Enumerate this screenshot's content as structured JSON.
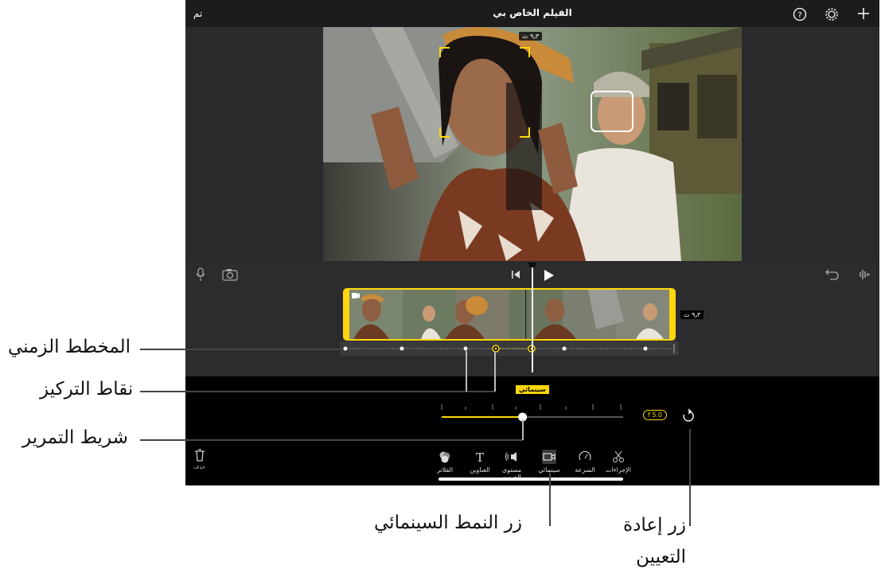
{
  "app": {
    "title": "الفيلم الخاص بي",
    "done_label": "تم",
    "duration_top": "٩٫٣ ث",
    "duration_clip": "٩٫٣ ث",
    "cinematic_badge": "سينمائي",
    "fstop_label": "f 5.0",
    "delete_label": "حذف",
    "accent_color": "#ffd60a",
    "scrubber_level": 0.48
  },
  "toolbar": [
    {
      "name": "actions",
      "label": "الإجراءات",
      "icon": "scissors-icon"
    },
    {
      "name": "speed",
      "label": "السرعة",
      "icon": "speedometer-icon"
    },
    {
      "name": "cinematic",
      "label": "سينمائي",
      "icon": "cinematic-camera-icon"
    },
    {
      "name": "volume",
      "label": "مستوى الصوت",
      "icon": "speaker-icon"
    },
    {
      "name": "titles",
      "label": "العناوين",
      "icon": "text-T-icon"
    },
    {
      "name": "filters",
      "label": "الفلاتر",
      "icon": "filters-circles-icon"
    }
  ],
  "callouts": {
    "timeline": "المخطط الزمني",
    "focus_points": "نقاط التركيز",
    "scrubber": "شريط التمرير",
    "cinematic_button": "زر النمط السينمائي",
    "reset_button": "زر إعادة التعيين"
  }
}
